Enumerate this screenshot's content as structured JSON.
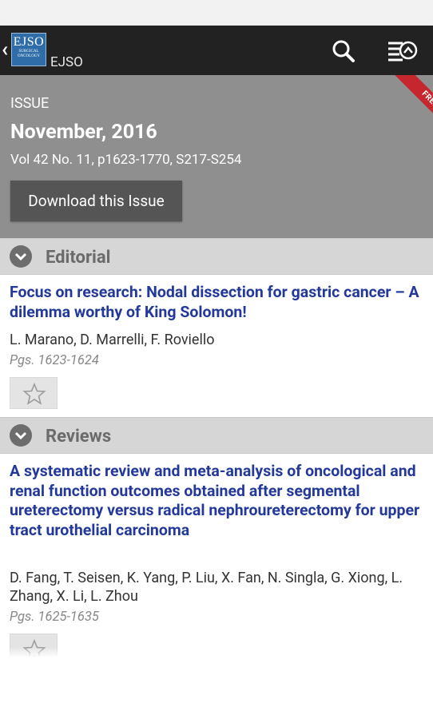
{
  "app_bar": {
    "logo_text": "EJSO",
    "logo_subtext": "SURGICAL ONCOLOGY",
    "title": "EJSO",
    "icons": [
      "back-chevron-icon",
      "search-icon",
      "table-of-contents-icon"
    ]
  },
  "issue": {
    "label": "ISSUE",
    "date": "November, 2016",
    "volume": "Vol 42 No. 11, p1623-1770, S217-S254",
    "download_label": "Download this Issue",
    "ribbon": "FREE"
  },
  "sections": [
    {
      "title": "Editorial",
      "articles": [
        {
          "title": "Focus on research: Nodal dissection for gastric cancer – A dilemma worthy of King Solomon!",
          "authors": "L. Marano, D. Marrelli, F. Roviello",
          "pages": "Pgs. 1623-1624"
        }
      ]
    },
    {
      "title": "Reviews",
      "articles": [
        {
          "title": "A systematic review and meta-analysis of oncological and renal function outcomes obtained after segmental ureterectomy versus radical nephroureterectomy for upper tract urothelial carcinoma",
          "authors": "D. Fang, T. Seisen, K. Yang, P. Liu, X. Fan, N. Singla, G. Xiong, L. Zhang, X. Li, L. Zhou",
          "pages": "Pgs. 1625-1635"
        }
      ]
    }
  ],
  "colors": {
    "app_bar": "#222222",
    "issue_header": "#8f8f8f",
    "ribbon": "#c6262e",
    "article_title": "#23399a",
    "section_header": "#d6d6d6"
  }
}
